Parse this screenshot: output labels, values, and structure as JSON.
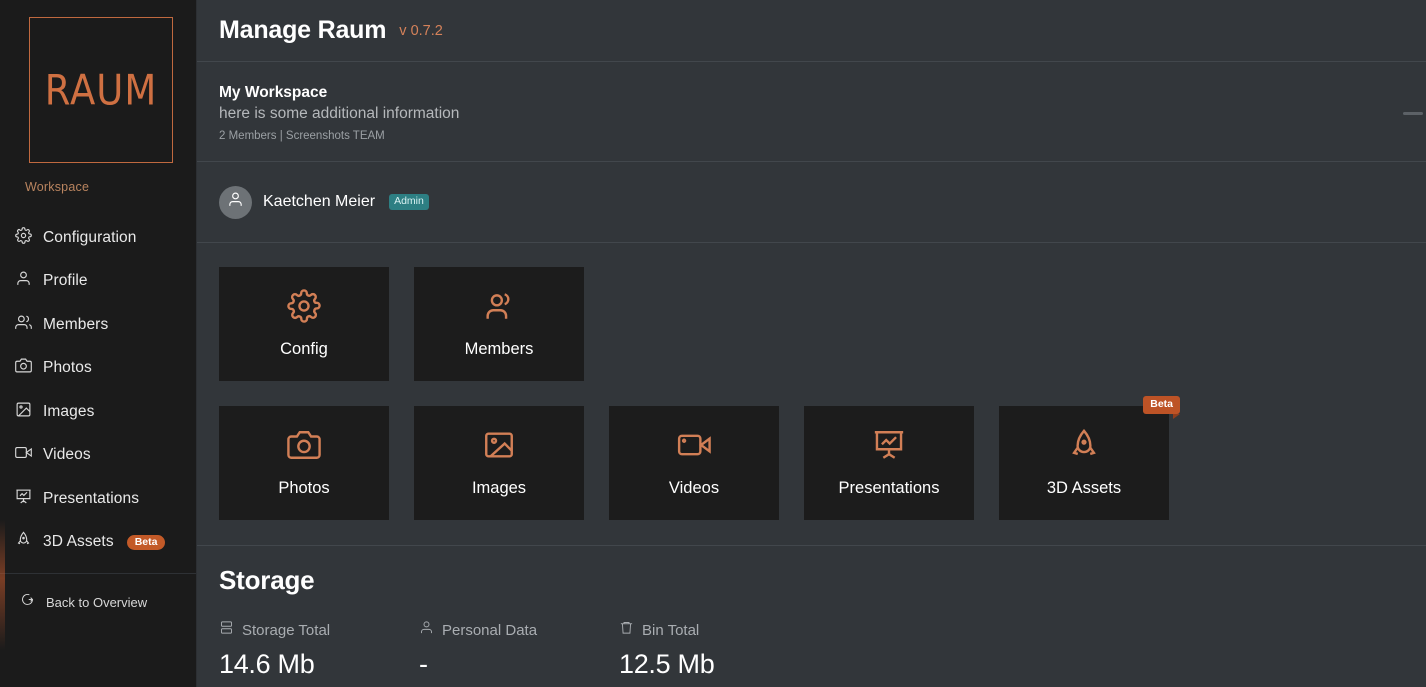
{
  "sidebar": {
    "logo_text": "RAUM",
    "workspace_label": "Workspace",
    "items": [
      {
        "label": "Configuration",
        "icon": "gear-icon"
      },
      {
        "label": "Profile",
        "icon": "user-icon"
      },
      {
        "label": "Members",
        "icon": "users-icon"
      },
      {
        "label": "Photos",
        "icon": "camera-icon"
      },
      {
        "label": "Images",
        "icon": "image-icon"
      },
      {
        "label": "Videos",
        "icon": "video-icon"
      },
      {
        "label": "Presentations",
        "icon": "presentation-icon"
      },
      {
        "label": "3D Assets",
        "icon": "rocket-icon",
        "badge": "Beta"
      }
    ],
    "back_link": {
      "label": "Back to Overview",
      "icon": "logout-icon"
    }
  },
  "header": {
    "title": "Manage Raum",
    "version": "v 0.7.2"
  },
  "workspace": {
    "name": "My Workspace",
    "description": "here is some additional information",
    "meta": "2 Members | Screenshots TEAM"
  },
  "user": {
    "name": "Kaetchen Meier",
    "role_badge": "Admin",
    "avatar_icon": "user-icon"
  },
  "cards": {
    "row1": [
      {
        "label": "Config",
        "icon": "gear-icon"
      },
      {
        "label": "Members",
        "icon": "users-icon"
      }
    ],
    "row2": [
      {
        "label": "Photos",
        "icon": "camera-icon"
      },
      {
        "label": "Images",
        "icon": "image-icon"
      },
      {
        "label": "Videos",
        "icon": "video-icon"
      },
      {
        "label": "Presentations",
        "icon": "presentation-icon"
      },
      {
        "label": "3D Assets",
        "icon": "rocket-icon",
        "badge": "Beta"
      }
    ]
  },
  "storage": {
    "title": "Storage",
    "stats": [
      {
        "label": "Storage Total",
        "value": "14.6 Mb",
        "icon": "server-icon"
      },
      {
        "label": "Personal Data",
        "value": "-",
        "icon": "user-icon"
      },
      {
        "label": "Bin Total",
        "value": "12.5 Mb",
        "icon": "trash-icon"
      }
    ]
  },
  "colors": {
    "accent": "#cf7042",
    "beta_badge": "#c35a28",
    "admin_badge": "#2d7f83",
    "main_bg": "#32363a",
    "sidebar_bg": "#1b1b1b",
    "card_bg": "#1c1c1c"
  }
}
